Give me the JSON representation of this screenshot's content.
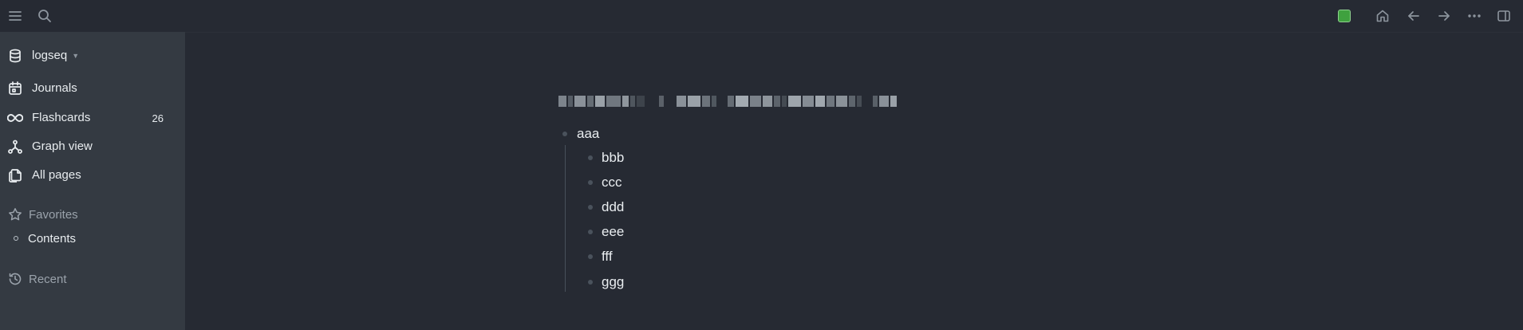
{
  "topbar": {
    "left_icons": [
      "menu-icon",
      "search-icon"
    ],
    "right_icons": [
      "sync-status-icon",
      "home-icon",
      "arrow-left-icon",
      "arrow-right-icon",
      "more-icon",
      "right-sidebar-icon"
    ],
    "sync_color": "#3fa13f"
  },
  "sidebar": {
    "graph": {
      "name": "logseq",
      "icon": "database-icon"
    },
    "nav": [
      {
        "label": "Journals",
        "icon": "calendar-icon"
      },
      {
        "label": "Flashcards",
        "icon": "infinity-icon",
        "count": "26"
      },
      {
        "label": "Graph view",
        "icon": "graph-icon"
      },
      {
        "label": "All pages",
        "icon": "pages-icon"
      }
    ],
    "favorites": {
      "label": "Favorites",
      "icon": "star-icon",
      "items": [
        {
          "label": "Contents"
        }
      ]
    },
    "recent": {
      "label": "Recent",
      "icon": "history-icon"
    }
  },
  "main": {
    "page_title_pixelated": true,
    "blocks": [
      {
        "text": "aaa",
        "children": [
          {
            "text": "bbb"
          },
          {
            "text": "ccc"
          },
          {
            "text": "ddd"
          },
          {
            "text": "eee"
          },
          {
            "text": "fff"
          },
          {
            "text": "ggg"
          }
        ]
      }
    ]
  },
  "colors": {
    "background": "#262a33",
    "sidebar": "#343a42",
    "text": "#e9edf0",
    "muted": "#9aa2ab",
    "bullet": "#4a525c"
  }
}
